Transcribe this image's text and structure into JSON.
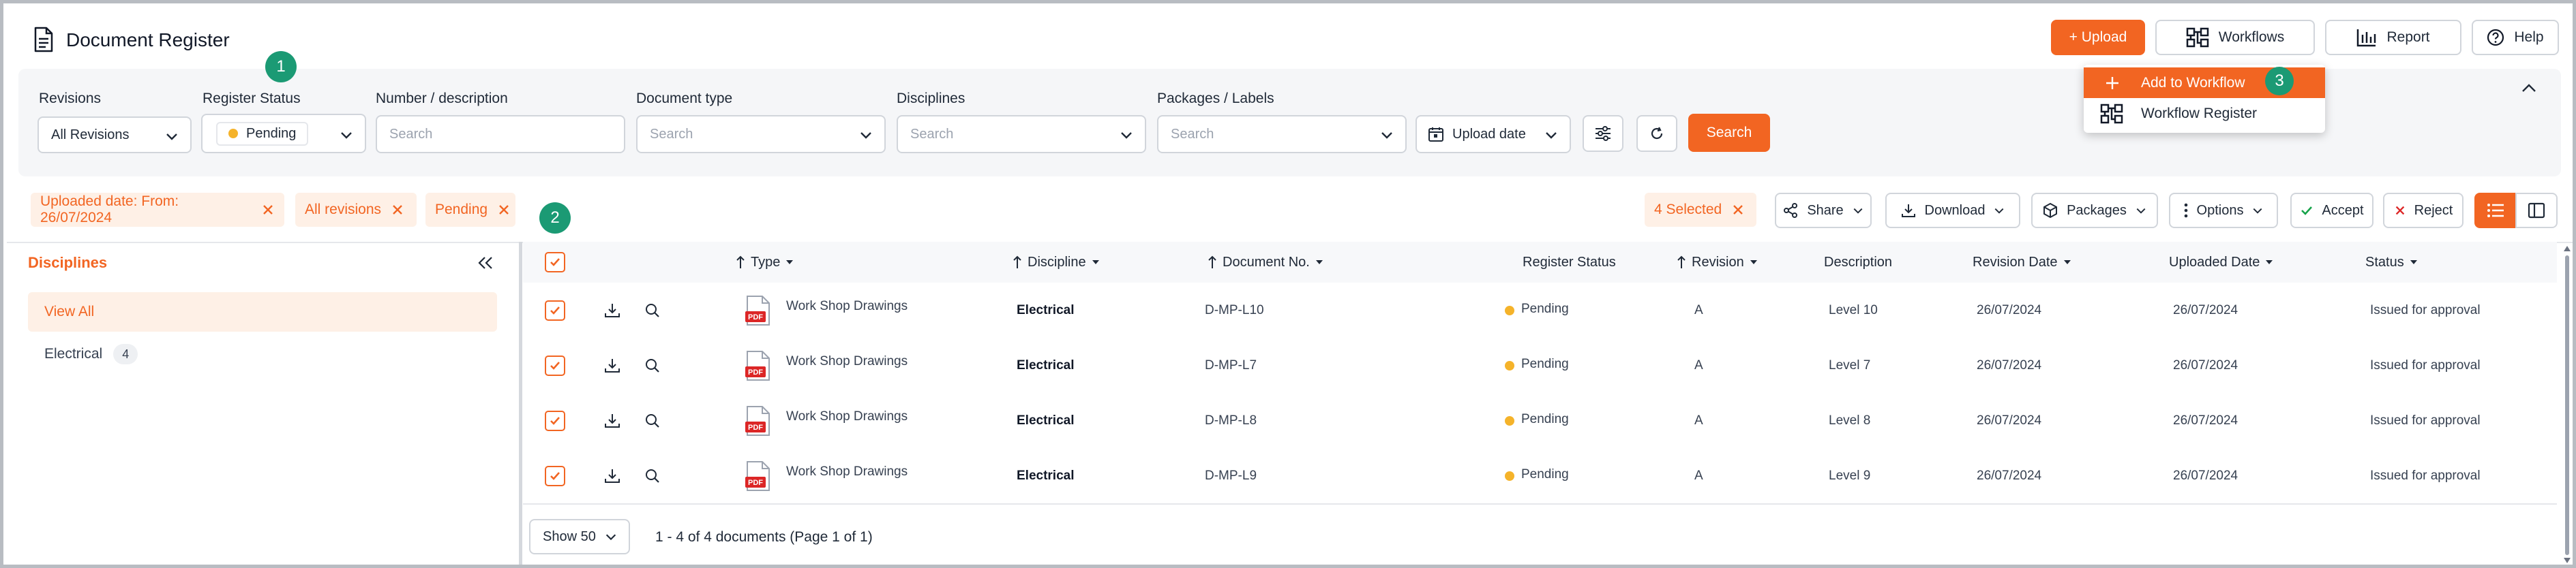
{
  "header": {
    "title": "Document Register",
    "upload_label": "+ Upload",
    "workflows_label": "Workflows",
    "report_label": "Report",
    "help_label": "Help"
  },
  "callouts": [
    "1",
    "2",
    "3"
  ],
  "filters": {
    "revisions": {
      "label": "Revisions",
      "value": "All Revisions"
    },
    "register_status": {
      "label": "Register Status",
      "value": "Pending"
    },
    "number_description": {
      "label": "Number / description",
      "placeholder": "Search"
    },
    "document_type": {
      "label": "Document type",
      "placeholder": "Search"
    },
    "disciplines": {
      "label": "Disciplines",
      "placeholder": "Search"
    },
    "packages_labels": {
      "label": "Packages / Labels",
      "placeholder": "Search"
    },
    "upload_date_label": "Upload date",
    "search_label": "Search"
  },
  "workflow_menu": {
    "items": [
      "Add to Workflow",
      "Workflow Register"
    ]
  },
  "active_filters": [
    "Uploaded date: From: 26/07/2024",
    "All revisions",
    "Pending"
  ],
  "toolbar": {
    "selected_label": "4 Selected",
    "share_label": "Share",
    "download_label": "Download",
    "packages_label": "Packages",
    "options_label": "Options",
    "accept_label": "Accept",
    "reject_label": "Reject"
  },
  "sidebar": {
    "title": "Disciplines",
    "items": [
      {
        "label": "View All"
      },
      {
        "label": "Electrical",
        "count": "4"
      }
    ]
  },
  "table": {
    "columns": {
      "type": "Type",
      "discipline": "Discipline",
      "document_no": "Document No.",
      "register_status": "Register Status",
      "revision": "Revision",
      "description": "Description",
      "revision_date": "Revision Date",
      "uploaded_date": "Uploaded Date",
      "status": "Status"
    },
    "rows": [
      {
        "type": "Work Shop Drawings",
        "discipline": "Electrical",
        "document_no": "D-MP-L10",
        "register_status": "Pending",
        "revision": "A",
        "description": "Level 10",
        "revision_date": "26/07/2024",
        "uploaded_date": "26/07/2024",
        "status": "Issued for approval"
      },
      {
        "type": "Work Shop Drawings",
        "discipline": "Electrical",
        "document_no": "D-MP-L7",
        "register_status": "Pending",
        "revision": "A",
        "description": "Level 7",
        "revision_date": "26/07/2024",
        "uploaded_date": "26/07/2024",
        "status": "Issued for approval"
      },
      {
        "type": "Work Shop Drawings",
        "discipline": "Electrical",
        "document_no": "D-MP-L8",
        "register_status": "Pending",
        "revision": "A",
        "description": "Level 8",
        "revision_date": "26/07/2024",
        "uploaded_date": "26/07/2024",
        "status": "Issued for approval"
      },
      {
        "type": "Work Shop Drawings",
        "discipline": "Electrical",
        "document_no": "D-MP-L9",
        "register_status": "Pending",
        "revision": "A",
        "description": "Level 9",
        "revision_date": "26/07/2024",
        "uploaded_date": "26/07/2024",
        "status": "Issued for approval"
      }
    ],
    "pdf_badge": "PDF"
  },
  "footer": {
    "page_size": "Show 50",
    "summary": "1 - 4 of 4 documents (Page 1 of 1)"
  },
  "colors": {
    "accent": "#f26522",
    "accent_light": "#fef0e6",
    "callout": "#1b9a74",
    "pending_dot": "#f5b32a",
    "accept_green": "#16a34a",
    "reject_red": "#dc2626"
  }
}
